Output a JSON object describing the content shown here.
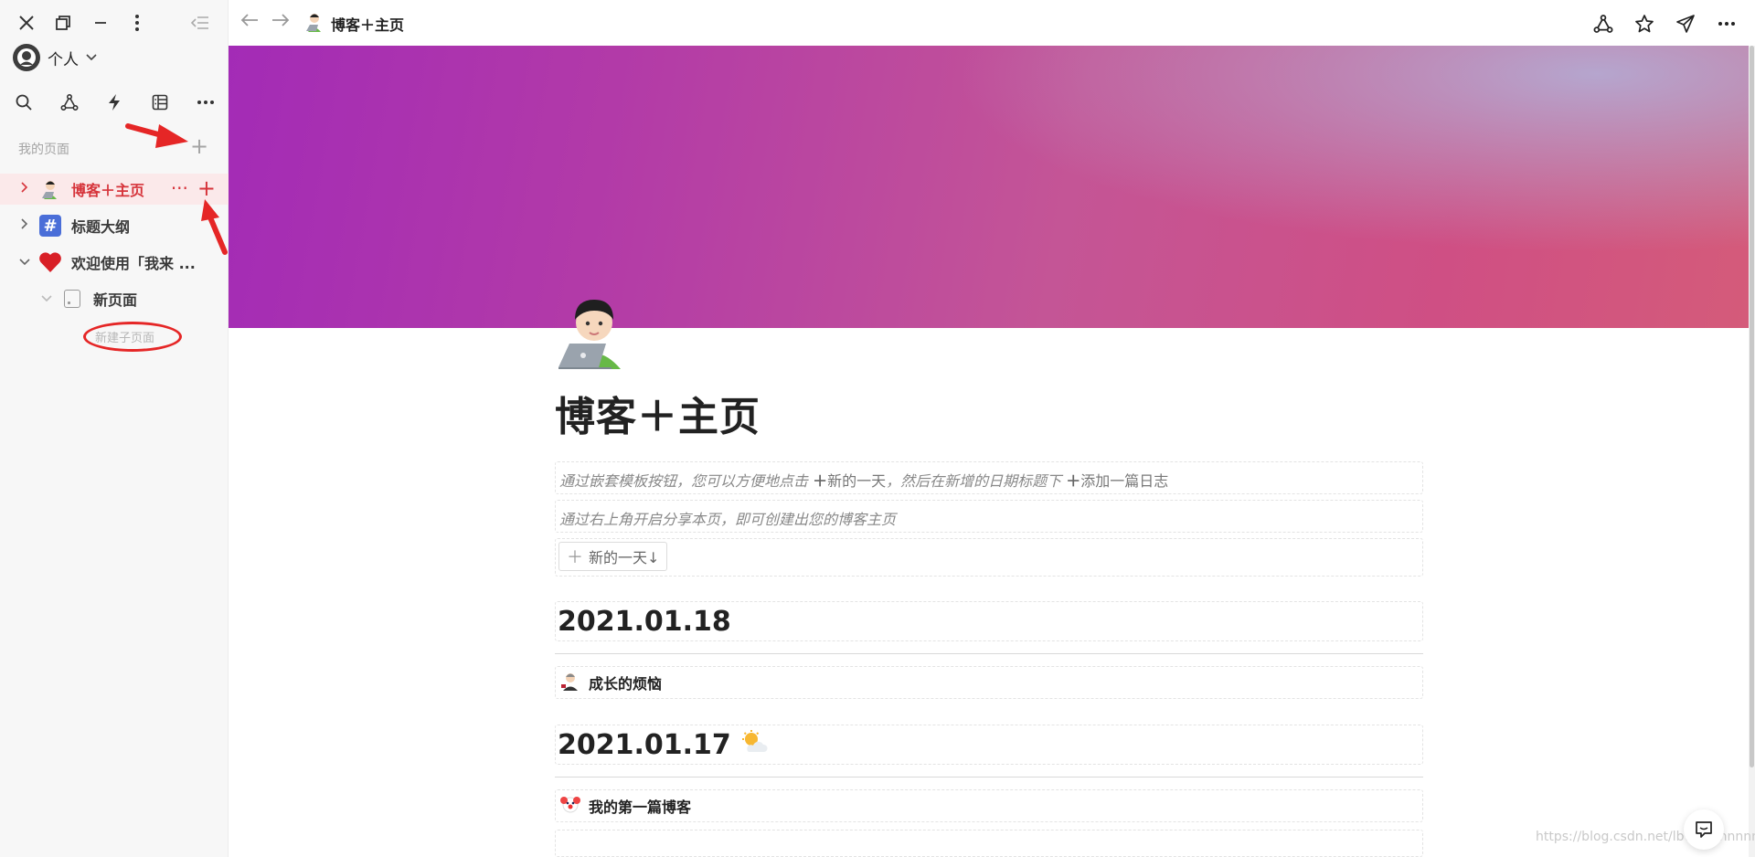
{
  "sidebar": {
    "workspace_name": "个人",
    "section_title": "我的页面",
    "section_add": "+",
    "pages": [
      {
        "label": "博客＋主页",
        "icon": "technologist-emoji",
        "active": true,
        "actions": [
          "···",
          "+"
        ]
      },
      {
        "label": "标题大纲",
        "icon": "hash-icon",
        "hash_glyph": "#"
      },
      {
        "label": "欢迎使用「我来 ...",
        "icon": "red-heart-emoji"
      },
      {
        "label": "新页面",
        "icon": "page-icon"
      }
    ],
    "new_subpage": "新建子页面",
    "annotation_color": "#e52626"
  },
  "topbar": {
    "title": "博客＋主页"
  },
  "page": {
    "title": "博客＋主页",
    "intro_1_italic": "通过嵌套模板按钮，您可以方便地点击",
    "intro_1_btn_a": "新的一天",
    "intro_1_mid": "，然后在新增的日期标题下",
    "intro_1_btn_b": "添加一篇日志",
    "intro_2": "通过右上角开启分享本页，即可创建出您的博客主页",
    "template_button": "新的一天↓",
    "entries": [
      {
        "date": "2021.01.18",
        "weather_icon": "",
        "post": "成长的烦恼",
        "post_icon": "office-worker-emoji"
      },
      {
        "date": "2021.01.17",
        "weather_icon": "sun-behind-cloud-emoji",
        "post": "我的第一篇博客",
        "post_icon": "clown-emoji"
      }
    ]
  },
  "watermark": "https://blog.csdn.net/lbwnnnnnnnn",
  "colors": {
    "accent_red": "#d6343b",
    "active_bg": "#fbe9ea",
    "cover_start": "#a32bb6",
    "cover_end": "#d45b7a"
  }
}
